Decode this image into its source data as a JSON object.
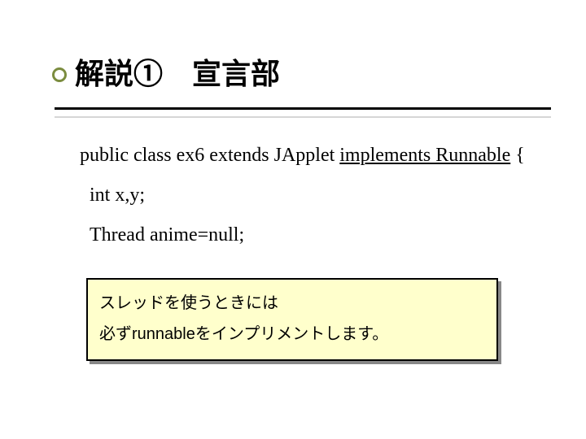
{
  "title": "解説①　宣言部",
  "code": {
    "line1_pre": "public class ex6 extends JApplet ",
    "line1_emph": "implements Runnable",
    "line1_post": " {",
    "line2": "int x,y;",
    "line3": "Thread anime=null;"
  },
  "note": {
    "line1": "スレッドを使うときには",
    "line2": "必ずrunnableをインプリメントします。"
  }
}
